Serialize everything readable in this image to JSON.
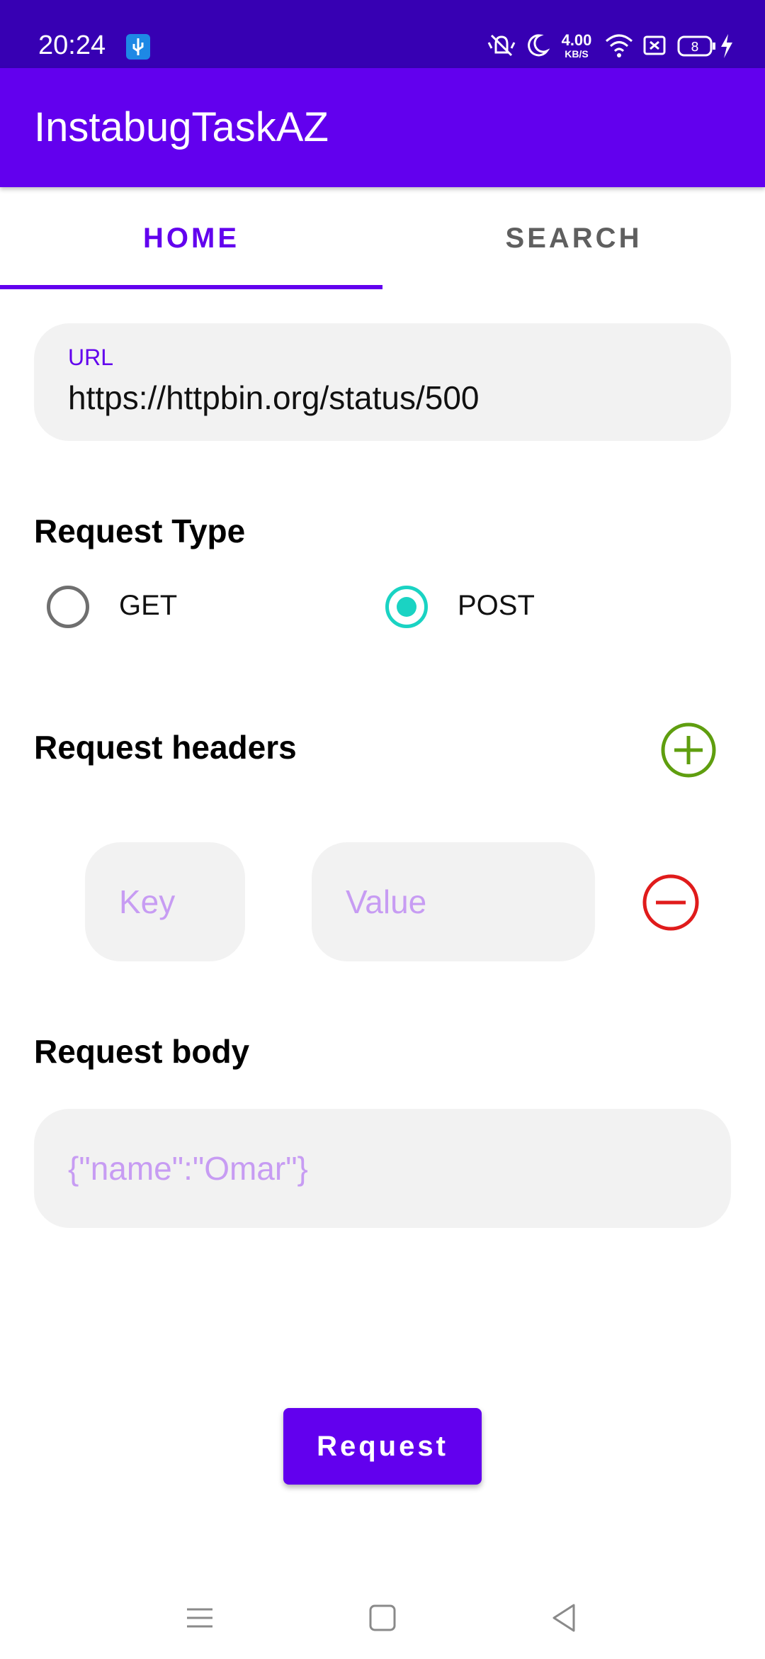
{
  "status_bar": {
    "time": "20:24",
    "speed_value": "4.00",
    "speed_unit": "KB/S",
    "battery_level": "8",
    "icons": [
      "usb-icon",
      "mute-icon",
      "moon-icon",
      "wifi-icon",
      "close-box-icon",
      "battery-icon",
      "charging-icon"
    ]
  },
  "app_bar": {
    "title": "InstabugTaskAZ"
  },
  "tabs": [
    {
      "label": "HOME",
      "selected": true
    },
    {
      "label": "SEARCH",
      "selected": false
    }
  ],
  "url_field": {
    "label": "URL",
    "value": "https://httpbin.org/status/500"
  },
  "request_type": {
    "title": "Request Type",
    "options": [
      {
        "label": "GET",
        "selected": false
      },
      {
        "label": "POST",
        "selected": true
      }
    ]
  },
  "request_headers": {
    "title": "Request headers",
    "key_placeholder": "Key",
    "value_placeholder": "Value"
  },
  "request_body": {
    "title": "Request body",
    "placeholder": "{\"name\":\"Omar\"}"
  },
  "request_button": {
    "label": "Request"
  },
  "colors": {
    "primary": "#6200ee",
    "status_bar": "#3700b3",
    "radio_accent": "#1ad3c3",
    "add_icon": "#5f9e0f",
    "remove_icon": "#e01b1b",
    "placeholder": "#c79cf3"
  }
}
